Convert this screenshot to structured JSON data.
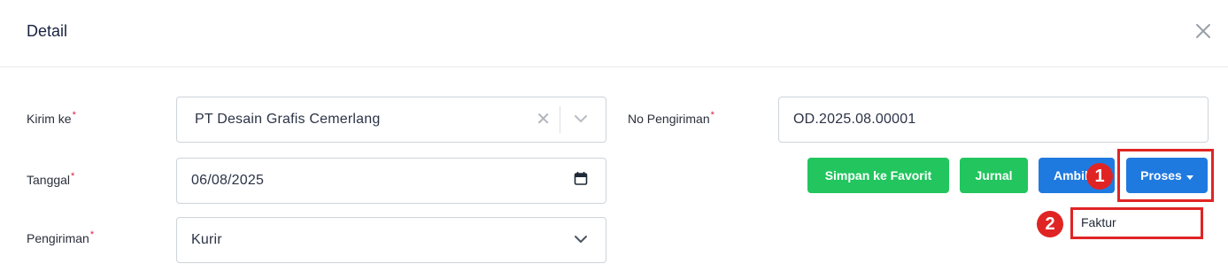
{
  "header": {
    "title": "Detail",
    "close_icon": "close-icon"
  },
  "form": {
    "kirim_ke": {
      "label": "Kirim ke",
      "required_mark": "*",
      "value": "PT Desain Grafis Cemerlang",
      "clear_symbol": "✕"
    },
    "no_pengiriman": {
      "label": "No Pengiriman",
      "required_mark": "*",
      "value": "OD.2025.08.00001"
    },
    "tanggal": {
      "label": "Tanggal",
      "required_mark": "*",
      "value": "06/08/2025"
    },
    "pengiriman": {
      "label": "Pengiriman",
      "required_mark": "*",
      "value": "Kurir"
    }
  },
  "actions": {
    "simpan_favorit": "Simpan ke Favorit",
    "jurnal": "Jurnal",
    "ambil": "Ambil",
    "proses": "Proses"
  },
  "dropdown": {
    "items": [
      "Faktur"
    ]
  },
  "annotations": {
    "step1": "1",
    "step2": "2"
  },
  "colors": {
    "green": "#22c55e",
    "blue": "#1f7ae0",
    "annotation_red": "#e02424",
    "required_red": "#e11d48"
  }
}
